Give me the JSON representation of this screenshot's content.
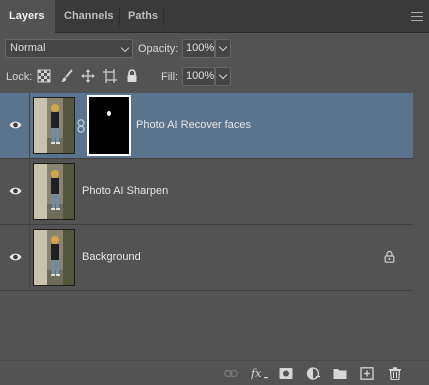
{
  "tabs": [
    {
      "label": "Layers"
    },
    {
      "label": "Channels"
    },
    {
      "label": "Paths"
    }
  ],
  "blend_mode": {
    "value": "Normal"
  },
  "opacity": {
    "label": "Opacity:",
    "value": "100%"
  },
  "lock": {
    "label": "Lock:"
  },
  "fill": {
    "label": "Fill:",
    "value": "100%"
  },
  "layers": [
    {
      "name": "Photo AI Recover faces",
      "visible": true,
      "selected": true,
      "has_mask": true
    },
    {
      "name": "Photo AI Sharpen",
      "visible": true,
      "selected": false
    },
    {
      "name": "Background",
      "visible": true,
      "selected": false,
      "locked": true
    }
  ],
  "colors": {
    "panel": "#535353",
    "selection": "#5b748d",
    "tabbar": "#3a3a3a"
  }
}
